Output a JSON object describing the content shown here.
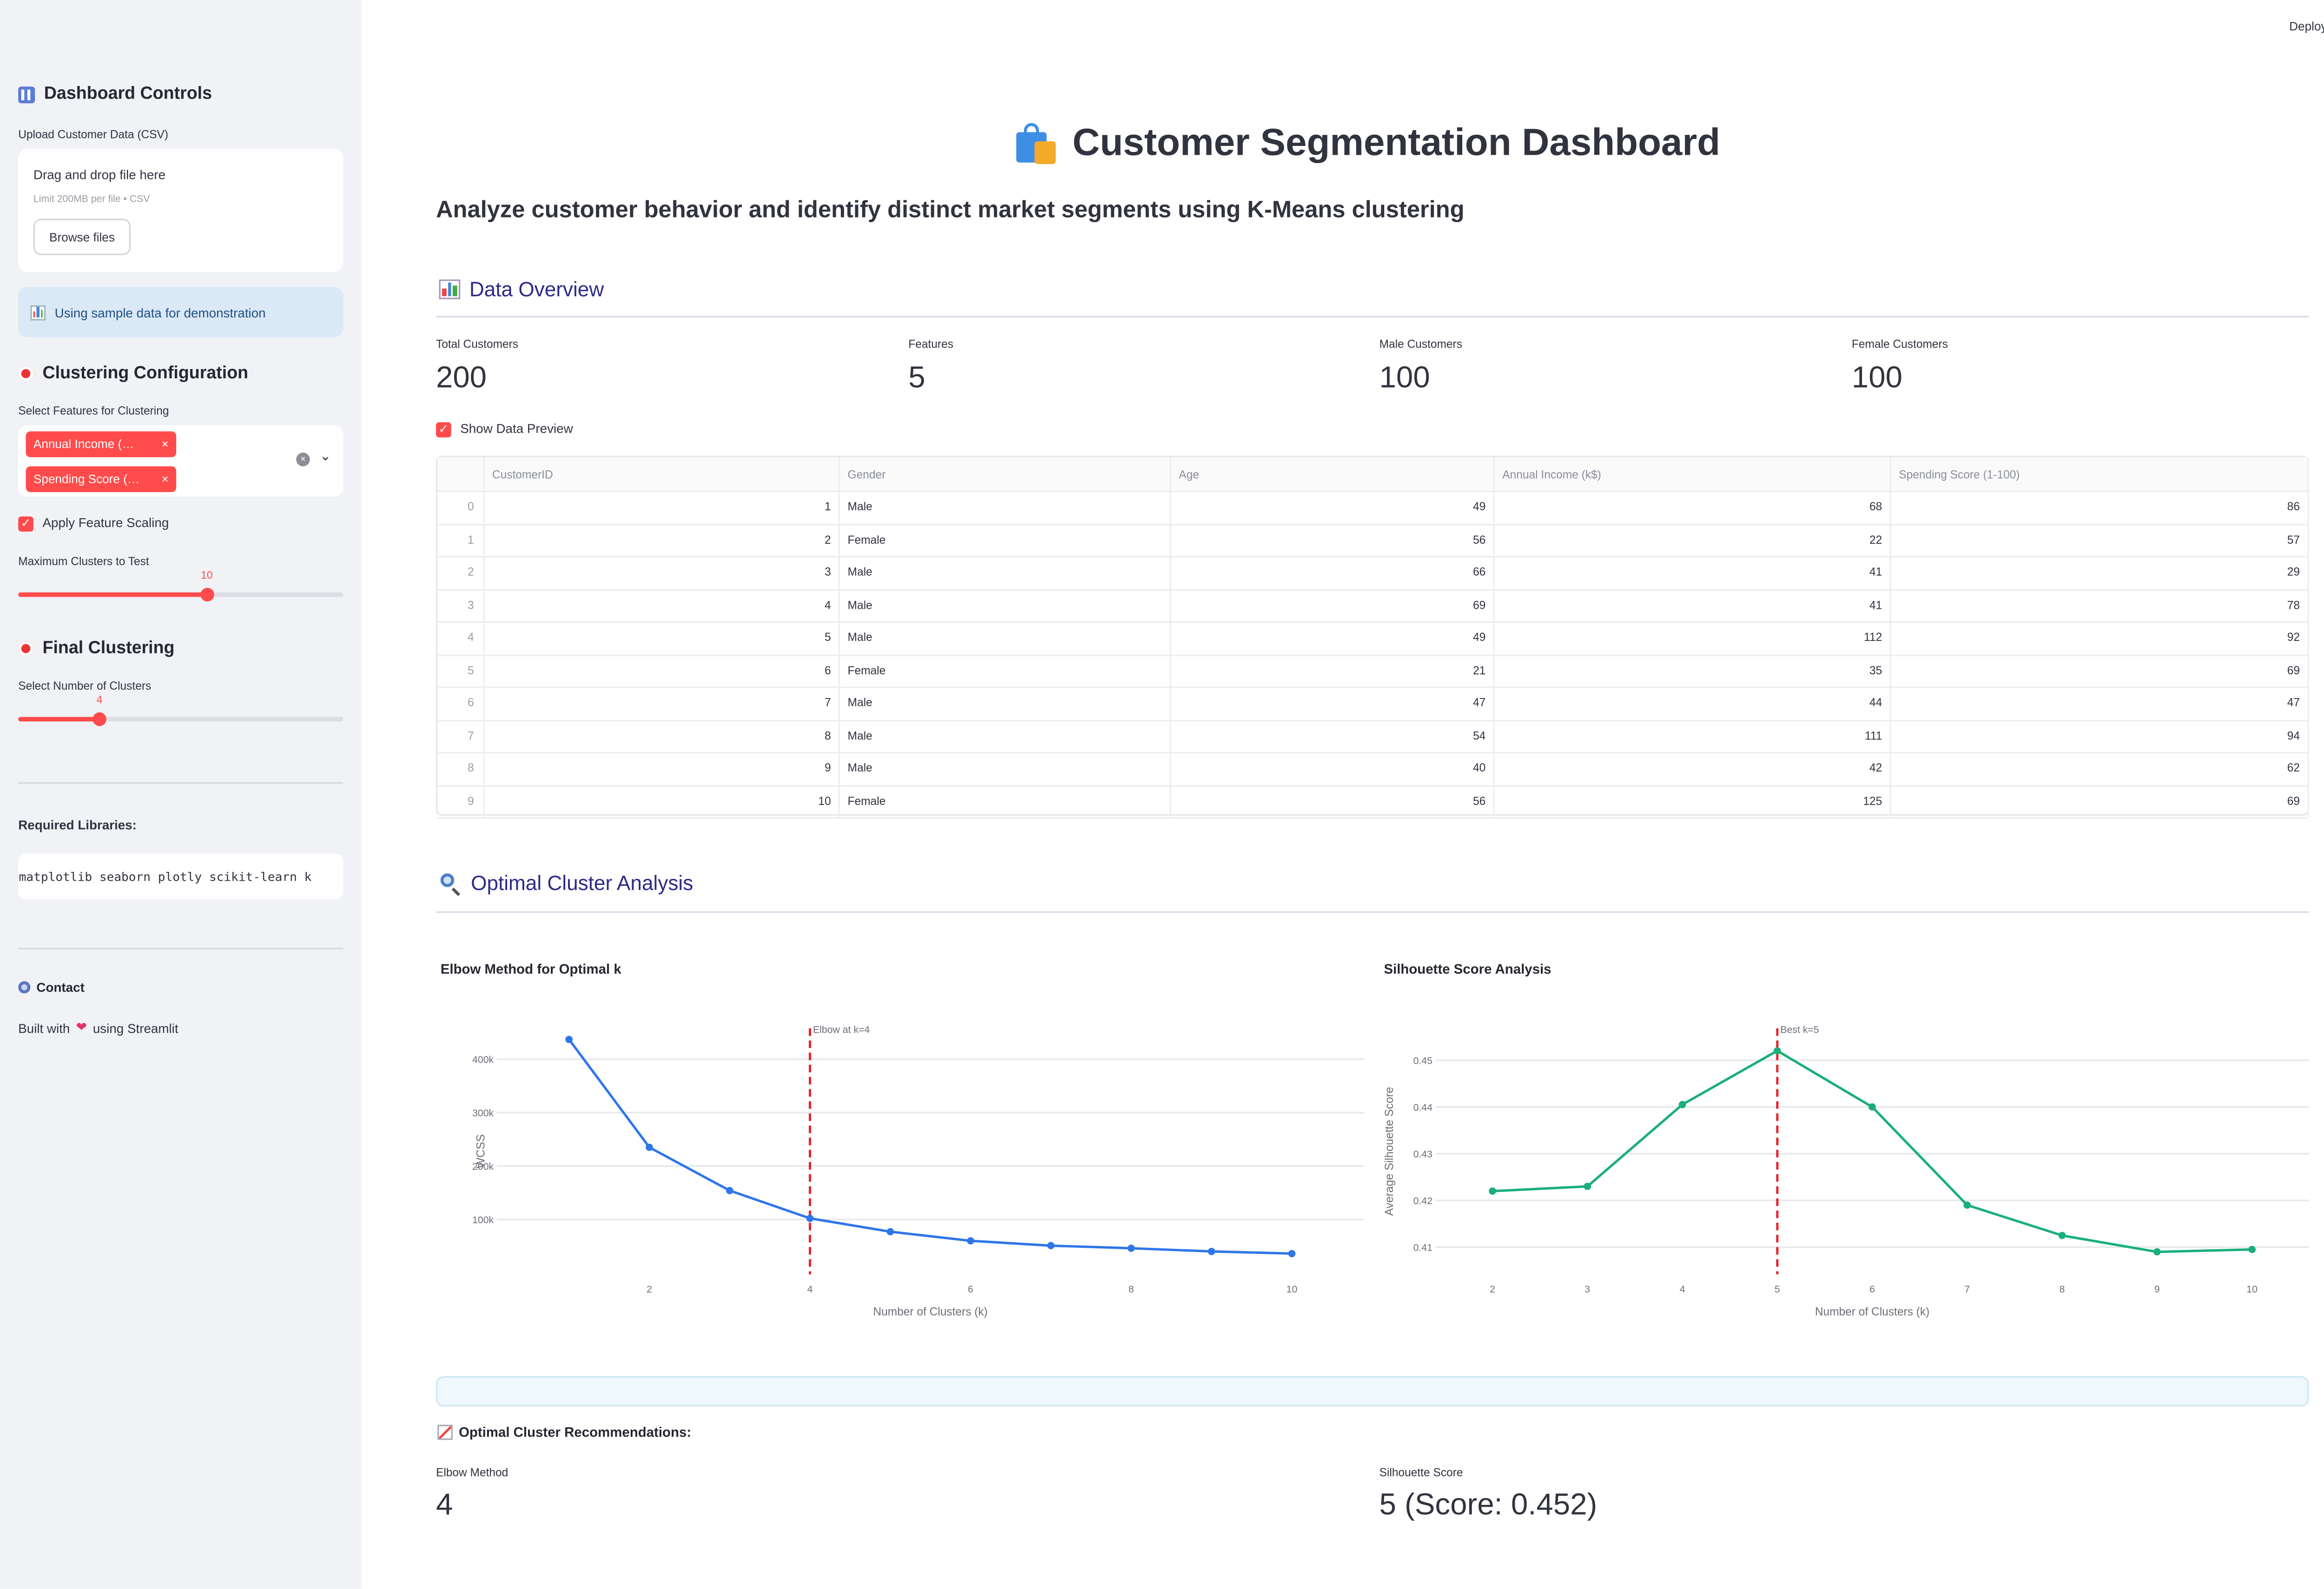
{
  "app": {
    "deploy_label": "Deploy",
    "menu_icon": "more-vert-icon"
  },
  "sidebar": {
    "dashboard_controls": "Dashboard Controls",
    "upload_label": "Upload Customer Data (CSV)",
    "drag_text": "Drag and drop file here",
    "limit_text": "Limit 200MB per file • CSV",
    "browse_label": "Browse files",
    "info_text": "Using sample data for demonstration",
    "clustering_config": "Clustering Configuration",
    "select_features_label": "Select Features for Clustering",
    "selected_features": [
      "Annual Income (…",
      "Spending Score (…"
    ],
    "apply_scaling_label": "Apply Feature Scaling",
    "apply_scaling_checked": true,
    "max_clusters_label": "Maximum Clusters to Test",
    "max_clusters_value": "10",
    "max_clusters_fraction": 0.58,
    "final_clustering": "Final Clustering",
    "num_clusters_label": "Select Number of Clusters",
    "num_clusters_value": "4",
    "num_clusters_fraction": 0.25,
    "required_libraries": "Required Libraries:",
    "libraries_code": "py matplotlib seaborn plotly scikit-learn k",
    "contact": "Contact",
    "built_with_prefix": "Built with",
    "built_with_suffix": "using Streamlit"
  },
  "main": {
    "title": "Customer Segmentation Dashboard",
    "subtitle": "Analyze customer behavior and identify distinct market segments using K-Means clustering",
    "data_overview": "Data Overview",
    "metrics": [
      {
        "label": "Total Customers",
        "value": "200"
      },
      {
        "label": "Features",
        "value": "5"
      },
      {
        "label": "Male Customers",
        "value": "100"
      },
      {
        "label": "Female Customers",
        "value": "100"
      }
    ],
    "show_preview_label": "Show Data Preview",
    "show_preview_checked": true,
    "table": {
      "columns": [
        "",
        "CustomerID",
        "Gender",
        "Age",
        "Annual Income (k$)",
        "Spending Score (1-100)"
      ],
      "rows": [
        [
          "0",
          "1",
          "Male",
          "49",
          "68",
          "86"
        ],
        [
          "1",
          "2",
          "Female",
          "56",
          "22",
          "57"
        ],
        [
          "2",
          "3",
          "Male",
          "66",
          "41",
          "29"
        ],
        [
          "3",
          "4",
          "Male",
          "69",
          "41",
          "78"
        ],
        [
          "4",
          "5",
          "Male",
          "49",
          "112",
          "92"
        ],
        [
          "5",
          "6",
          "Female",
          "21",
          "35",
          "69"
        ],
        [
          "6",
          "7",
          "Male",
          "47",
          "44",
          "47"
        ],
        [
          "7",
          "8",
          "Male",
          "54",
          "111",
          "94"
        ],
        [
          "8",
          "9",
          "Male",
          "40",
          "42",
          "62"
        ],
        [
          "9",
          "10",
          "Female",
          "56",
          "125",
          "69"
        ]
      ]
    },
    "optimal_cluster_analysis": "Optimal Cluster Analysis",
    "recommendations_heading": "Optimal Cluster Recommendations:",
    "recommendations": [
      {
        "label": "Elbow Method",
        "value": "4"
      },
      {
        "label": "Silhouette Score",
        "value": "5 (Score: 0.452)"
      }
    ]
  },
  "chart_data": [
    {
      "type": "line",
      "title": "Elbow Method for Optimal k",
      "xlabel": "Number of Clusters (k)",
      "ylabel": "WCSS",
      "x": [
        1,
        2,
        3,
        4,
        5,
        6,
        7,
        8,
        9,
        10
      ],
      "values": [
        437000,
        235000,
        154000,
        102000,
        77000,
        60000,
        51000,
        46000,
        40000,
        36000
      ],
      "xticks": [
        2,
        4,
        6,
        8,
        10
      ],
      "yticks": [
        100000,
        200000,
        300000,
        400000
      ],
      "ytick_labels": [
        "100k",
        "200k",
        "300k",
        "400k"
      ],
      "xlim": [
        0.1,
        10.9
      ],
      "ylim": [
        0,
        455000
      ],
      "color": "#2f76e8",
      "vline": {
        "x": 4,
        "label": "Elbow at k=4",
        "color": "#e8202a"
      },
      "grid": true
    },
    {
      "type": "line",
      "title": "Silhouette Score Analysis",
      "xlabel": "Number of Clusters (k)",
      "ylabel": "Average Silhouette Score",
      "x": [
        2,
        3,
        4,
        5,
        6,
        7,
        8,
        9,
        10
      ],
      "values": [
        0.422,
        0.423,
        0.4405,
        0.452,
        0.44,
        0.419,
        0.4125,
        0.409,
        0.4095
      ],
      "xticks": [
        2,
        3,
        4,
        5,
        6,
        7,
        8,
        9,
        10
      ],
      "yticks": [
        0.41,
        0.42,
        0.43,
        0.44,
        0.45
      ],
      "ytick_labels": [
        "0.41",
        "0.42",
        "0.43",
        "0.44",
        "0.45"
      ],
      "xlim": [
        1.4,
        10.6
      ],
      "ylim": [
        0.4045,
        0.4565
      ],
      "color": "#1aaf7a",
      "vline": {
        "x": 5,
        "label": "Best k=5",
        "color": "#e8202a"
      },
      "grid": true
    }
  ]
}
